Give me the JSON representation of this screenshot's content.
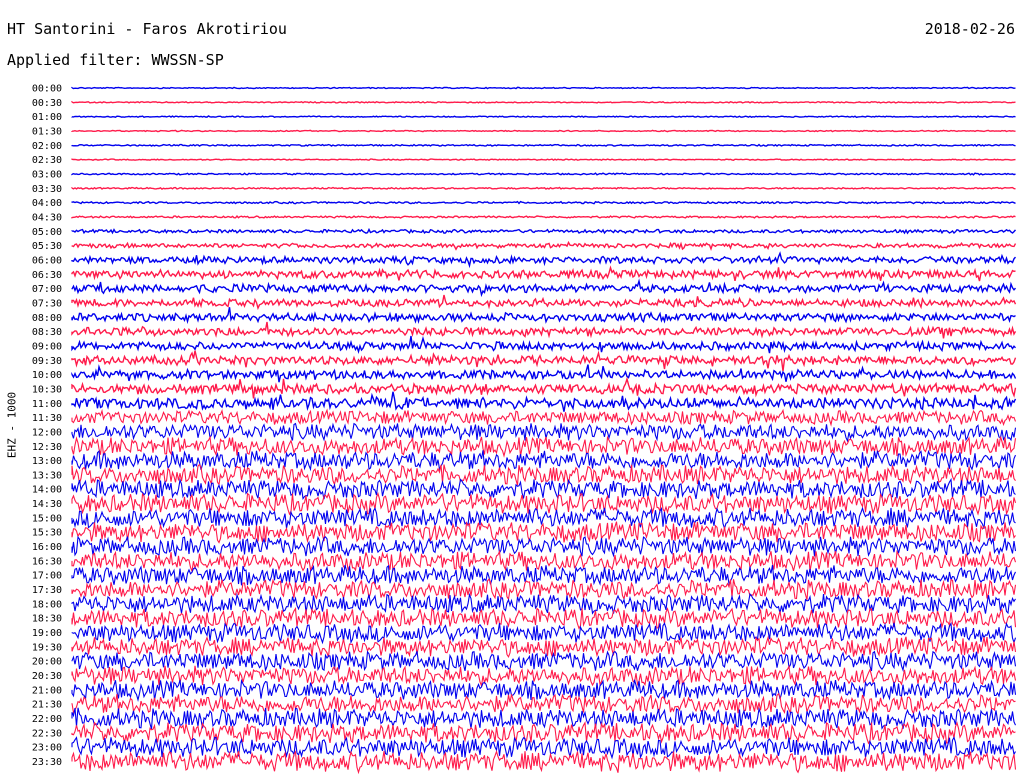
{
  "header": {
    "station_title": "HT Santorini - Faros Akrotiriou",
    "date": "2018-02-26",
    "filter_label": "Applied filter: WWSSN-SP"
  },
  "chart_data": {
    "type": "line",
    "title": "HT Santorini - Faros Akrotiriou",
    "ylabel": "EHZ - 1000",
    "xlabel": "",
    "grid": false,
    "legend": "none",
    "trace_colors": [
      "#0000ee",
      "#ff1a4a"
    ],
    "rows": [
      {
        "label": "00:00",
        "amplitude": 0.15
      },
      {
        "label": "00:30",
        "amplitude": 0.15
      },
      {
        "label": "01:00",
        "amplitude": 0.15
      },
      {
        "label": "01:30",
        "amplitude": 0.15
      },
      {
        "label": "02:00",
        "amplitude": 0.2
      },
      {
        "label": "02:30",
        "amplitude": 0.15
      },
      {
        "label": "03:00",
        "amplitude": 0.2
      },
      {
        "label": "03:30",
        "amplitude": 0.2
      },
      {
        "label": "04:00",
        "amplitude": 0.25
      },
      {
        "label": "04:30",
        "amplitude": 0.25
      },
      {
        "label": "05:00",
        "amplitude": 0.45
      },
      {
        "label": "05:30",
        "amplitude": 0.6
      },
      {
        "label": "06:00",
        "amplitude": 0.9
      },
      {
        "label": "06:30",
        "amplitude": 1.1
      },
      {
        "label": "07:00",
        "amplitude": 1.1
      },
      {
        "label": "07:30",
        "amplitude": 1.0
      },
      {
        "label": "08:00",
        "amplitude": 1.1
      },
      {
        "label": "08:30",
        "amplitude": 1.1
      },
      {
        "label": "09:00",
        "amplitude": 1.1
      },
      {
        "label": "09:30",
        "amplitude": 1.2
      },
      {
        "label": "10:00",
        "amplitude": 1.2
      },
      {
        "label": "10:30",
        "amplitude": 1.3
      },
      {
        "label": "11:00",
        "amplitude": 1.5
      },
      {
        "label": "11:30",
        "amplitude": 1.8
      },
      {
        "label": "12:00",
        "amplitude": 2.2
      },
      {
        "label": "12:30",
        "amplitude": 2.4
      },
      {
        "label": "13:00",
        "amplitude": 2.5
      },
      {
        "label": "13:30",
        "amplitude": 2.5
      },
      {
        "label": "14:00",
        "amplitude": 2.5
      },
      {
        "label": "14:30",
        "amplitude": 2.6
      },
      {
        "label": "15:00",
        "amplitude": 2.6
      },
      {
        "label": "15:30",
        "amplitude": 2.6
      },
      {
        "label": "16:00",
        "amplitude": 2.5
      },
      {
        "label": "16:30",
        "amplitude": 2.5
      },
      {
        "label": "17:00",
        "amplitude": 2.5
      },
      {
        "label": "17:30",
        "amplitude": 2.5
      },
      {
        "label": "18:00",
        "amplitude": 2.5
      },
      {
        "label": "18:30",
        "amplitude": 2.5
      },
      {
        "label": "19:00",
        "amplitude": 2.5
      },
      {
        "label": "19:30",
        "amplitude": 2.5
      },
      {
        "label": "20:00",
        "amplitude": 2.5
      },
      {
        "label": "20:30",
        "amplitude": 2.5
      },
      {
        "label": "21:00",
        "amplitude": 2.5
      },
      {
        "label": "21:30",
        "amplitude": 2.5
      },
      {
        "label": "22:00",
        "amplitude": 2.6
      },
      {
        "label": "22:30",
        "amplitude": 2.6
      },
      {
        "label": "23:00",
        "amplitude": 2.6
      },
      {
        "label": "23:30",
        "amplitude": 2.7
      }
    ]
  }
}
